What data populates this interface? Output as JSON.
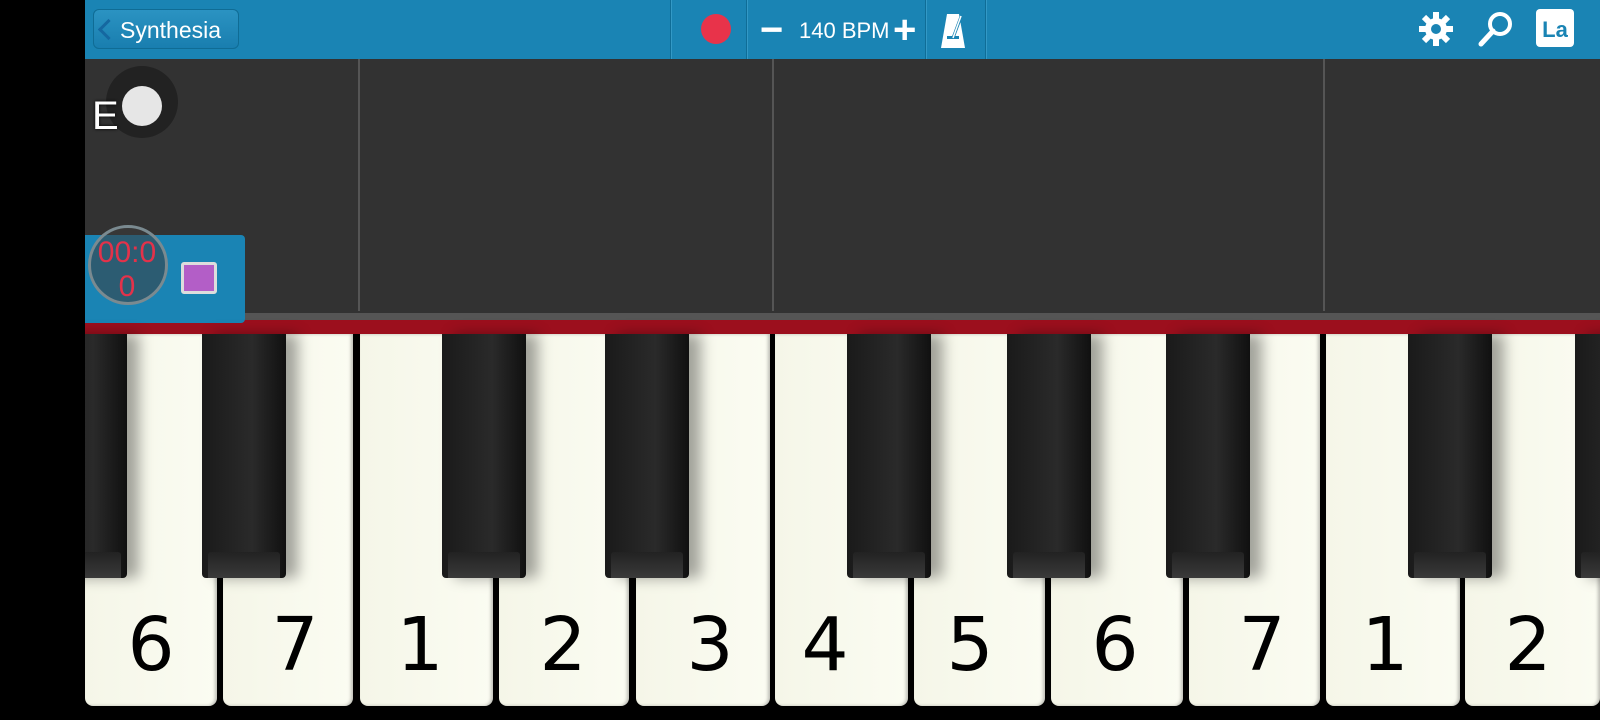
{
  "toolbar": {
    "back_label": "Synthesia",
    "bpm_text": "140 BPM",
    "minus_symbol": "−",
    "plus_symbol": "+",
    "la_label": "La",
    "record_color": "#e8334a",
    "bar_color": "#1a84b4"
  },
  "overlay": {
    "e_label": "E",
    "timer": "00:00"
  },
  "keyboard": {
    "labels": [
      "6",
      "7",
      "1",
      "2",
      "3",
      "4",
      "5",
      "6",
      "7",
      "1",
      "2"
    ]
  }
}
